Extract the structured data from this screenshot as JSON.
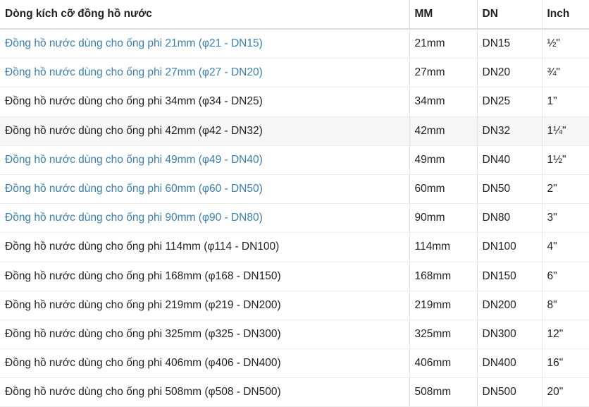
{
  "table": {
    "headers": [
      "Dòng kích cỡ đồng hồ nước",
      "MM",
      "DN",
      "Inch"
    ],
    "rows": [
      {
        "name": "Đồng hồ nước dùng cho ống phi 21mm (φ21 - DN15)",
        "mm": "21mm",
        "dn": "DN15",
        "inch": "½\"",
        "link": true
      },
      {
        "name": "Đồng hồ nước dùng cho ống phi 27mm (φ27 - DN20)",
        "mm": "27mm",
        "dn": "DN20",
        "inch": "¾\"",
        "link": true
      },
      {
        "name": "Đồng hồ nước dùng cho ống phi 34mm (φ34 - DN25)",
        "mm": "34mm",
        "dn": "DN25",
        "inch": "1\"",
        "link": false
      },
      {
        "name": "Đồng hồ nước dùng cho ống phi 42mm (φ42 - DN32)",
        "mm": "42mm",
        "dn": "DN32",
        "inch": "1¼\"",
        "link": false
      },
      {
        "name": "Đồng hồ nước dùng cho ống phi 49mm (φ49 - DN40)",
        "mm": "49mm",
        "dn": "DN40",
        "inch": "1½\"",
        "link": true
      },
      {
        "name": "Đồng hồ nước dùng cho ống phi 60mm (φ60 - DN50)",
        "mm": "60mm",
        "dn": "DN50",
        "inch": "2\"",
        "link": true
      },
      {
        "name": "Đồng hồ nước dùng cho ống phi 90mm (φ90 - DN80)",
        "mm": "90mm",
        "dn": "DN80",
        "inch": "3\"",
        "link": true
      },
      {
        "name": "Đồng hồ nước dùng cho ống phi 114mm (φ114 - DN100)",
        "mm": "114mm",
        "dn": "DN100",
        "inch": "4\"",
        "link": false
      },
      {
        "name": "Đồng hồ nước dùng cho ống phi 168mm (φ168 - DN150)",
        "mm": "168mm",
        "dn": "DN150",
        "inch": "6\"",
        "link": false
      },
      {
        "name": "Đồng hồ nước dùng cho ống phi 219mm (φ219 - DN200)",
        "mm": "219mm",
        "dn": "DN200",
        "inch": "8\"",
        "link": false
      },
      {
        "name": "Đồng hồ nước dùng cho ống phi 325mm (φ325 - DN300)",
        "mm": "325mm",
        "dn": "DN300",
        "inch": "12\"",
        "link": false
      },
      {
        "name": "Đồng hồ nước dùng cho ống phi 406mm (φ406 - DN400)",
        "mm": "406mm",
        "dn": "DN400",
        "inch": "16\"",
        "link": false
      },
      {
        "name": "Đồng hồ nước dùng cho ống phi 508mm (φ508 - DN500)",
        "mm": "508mm",
        "dn": "DN500",
        "inch": "20\"",
        "link": false
      }
    ]
  },
  "colors": {
    "link": "#3a7fae",
    "text": "#222222",
    "alt_row": "#f6f6f6"
  }
}
